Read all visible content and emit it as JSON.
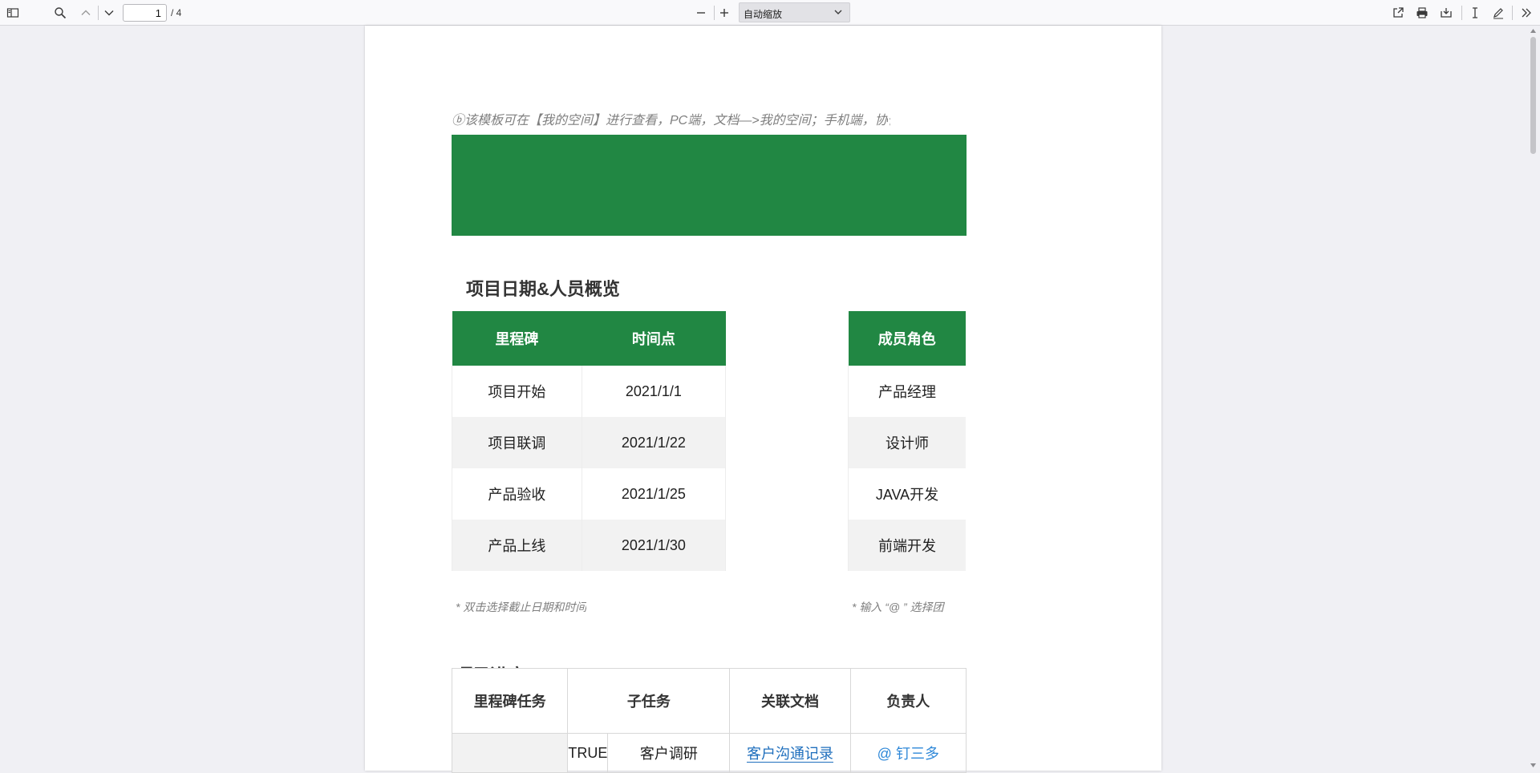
{
  "toolbar": {
    "page_number": "1",
    "page_total": "/ 4",
    "zoom_value": "自动缩放"
  },
  "colors": {
    "brand_green": "#218743",
    "true_green": "#70ad47",
    "link_blue": "#1f6fbd"
  },
  "document": {
    "top_note": "ⓑ该模板可在【我的空间】进行查看，PC端，文档—>我的空间；手机端，协作—>文档—",
    "section1_title": "项目日期&人员概览",
    "milestones": {
      "headers": [
        "里程碑",
        "时间点"
      ],
      "rows": [
        [
          "项目开始",
          "2021/1/1"
        ],
        [
          "项目联调",
          "2021/1/22"
        ],
        [
          "产品验收",
          "2021/1/25"
        ],
        [
          "产品上线",
          "2021/1/30"
        ]
      ]
    },
    "roles": {
      "header": "成员角色",
      "rows": [
        "产品经理",
        "设计师",
        "JAVA开发",
        "前端开发"
      ]
    },
    "hint_left": "* 双击选择截止日期和时间",
    "hint_right": "* 输入 “@ ” 选择团",
    "section2_title": "项目进度",
    "progress": {
      "headers": [
        "里程碑任务",
        "子任务",
        "关联文档",
        "负责人"
      ],
      "row1": {
        "check_value": "TRUE",
        "subtask": "客户调研",
        "doc": "客户沟通记录",
        "owner": "@ 钉三多"
      }
    }
  }
}
